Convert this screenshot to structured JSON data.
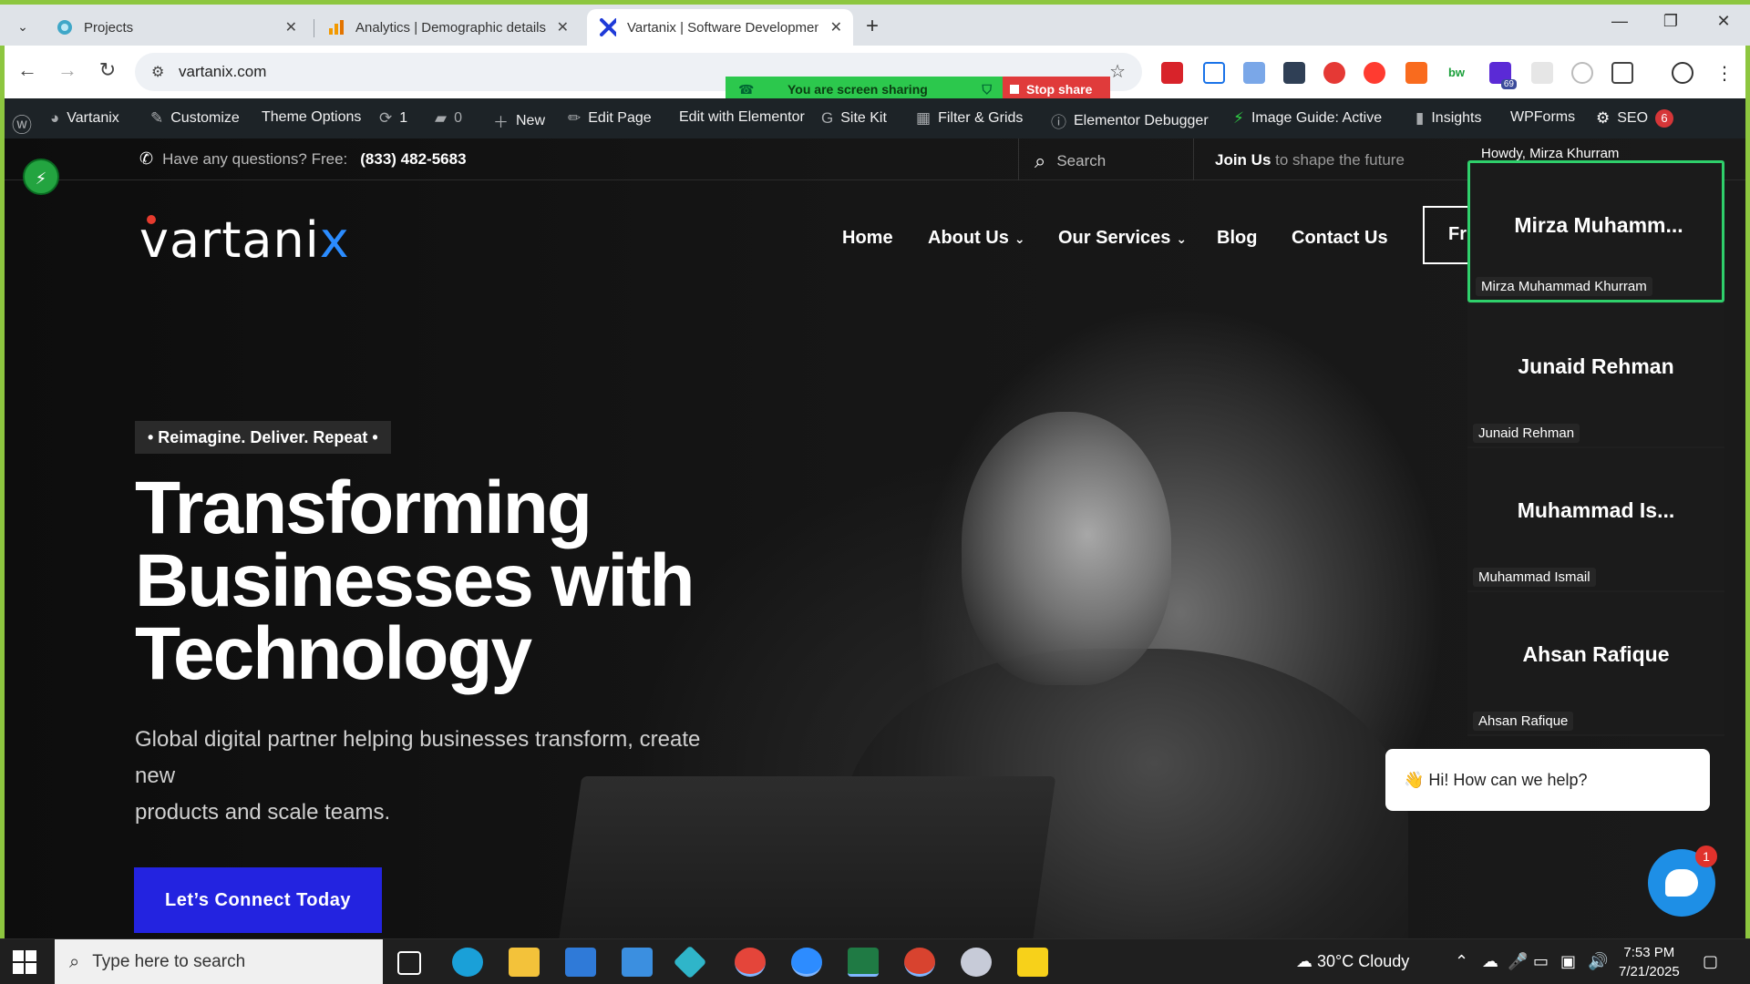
{
  "browser": {
    "tabs": [
      {
        "title": "Projects",
        "icon": "projects-icon",
        "active": false
      },
      {
        "title": "Analytics | Demographic details",
        "icon": "analytics-icon",
        "active": false
      },
      {
        "title": "Vartanix | Software Developmen",
        "icon": "vartanix-icon",
        "active": true
      }
    ],
    "new_tab": "+",
    "url": "vartanix.com",
    "screen_sharing": {
      "label": "You are screen sharing",
      "stop_label": "Stop share"
    },
    "extension_badge": "69"
  },
  "wp_admin_bar": {
    "site_name": "Vartanix",
    "customize": "Customize",
    "theme_options": "Theme Options",
    "updates_count": "1",
    "comments_count": "0",
    "new": "New",
    "edit_page": "Edit Page",
    "edit_elementor": "Edit with Elementor",
    "site_kit": "Site Kit",
    "filter_grids": "Filter & Grids",
    "elementor_debugger": "Elementor Debugger",
    "image_guide": "Image Guide: Active",
    "insights": "Insights",
    "wpforms": "WPForms",
    "seo": "SEO",
    "seo_count": "6"
  },
  "site": {
    "topinfo": {
      "question": "Have any questions? Free:",
      "phone": "(833) 482-5683",
      "search_placeholder": "Search",
      "join_strong": "Join Us",
      "join_rest": " to shape the future",
      "howdy": "Howdy, Mirza Khurram"
    },
    "logo": {
      "main": "vartani",
      "x": "x"
    },
    "nav": {
      "home": "Home",
      "about": "About Us",
      "services": "Our Services",
      "blog": "Blog",
      "contact": "Contact Us",
      "cta_partial": "Fr"
    },
    "hero": {
      "eyebrow": "• Reimagine. Deliver. Repeat •",
      "headline_1": "Transforming",
      "headline_2": "Businesses with",
      "headline_3": "Technology",
      "sub_1": "Global digital partner helping businesses transform, create",
      "sub_2": "new",
      "sub_3": "products and scale teams.",
      "cta": "Let’s Connect Today"
    },
    "chat": {
      "greeting": "👋 Hi! How can we help?",
      "badge": "1"
    }
  },
  "participants": [
    {
      "display": "Mirza  Muhamm...",
      "name": "Mirza Muhammad Khurram",
      "speaking": true
    },
    {
      "display": "Junaid Rehman",
      "name": "Junaid Rehman",
      "speaking": false
    },
    {
      "display": "Muhammad  Is...",
      "name": "Muhammad Ismail",
      "speaking": false
    },
    {
      "display": "Ahsan Rafique",
      "name": "Ahsan Rafique",
      "speaking": false
    }
  ],
  "taskbar": {
    "search_placeholder": "Type here to search",
    "weather": "30°C  Cloudy",
    "time": "7:53 PM",
    "date": "7/21/2025"
  },
  "colors": {
    "accent": "#2323e0",
    "speaking": "#2fd06b",
    "share_green": "#2cc84d",
    "stop_red": "#e03b3b"
  }
}
